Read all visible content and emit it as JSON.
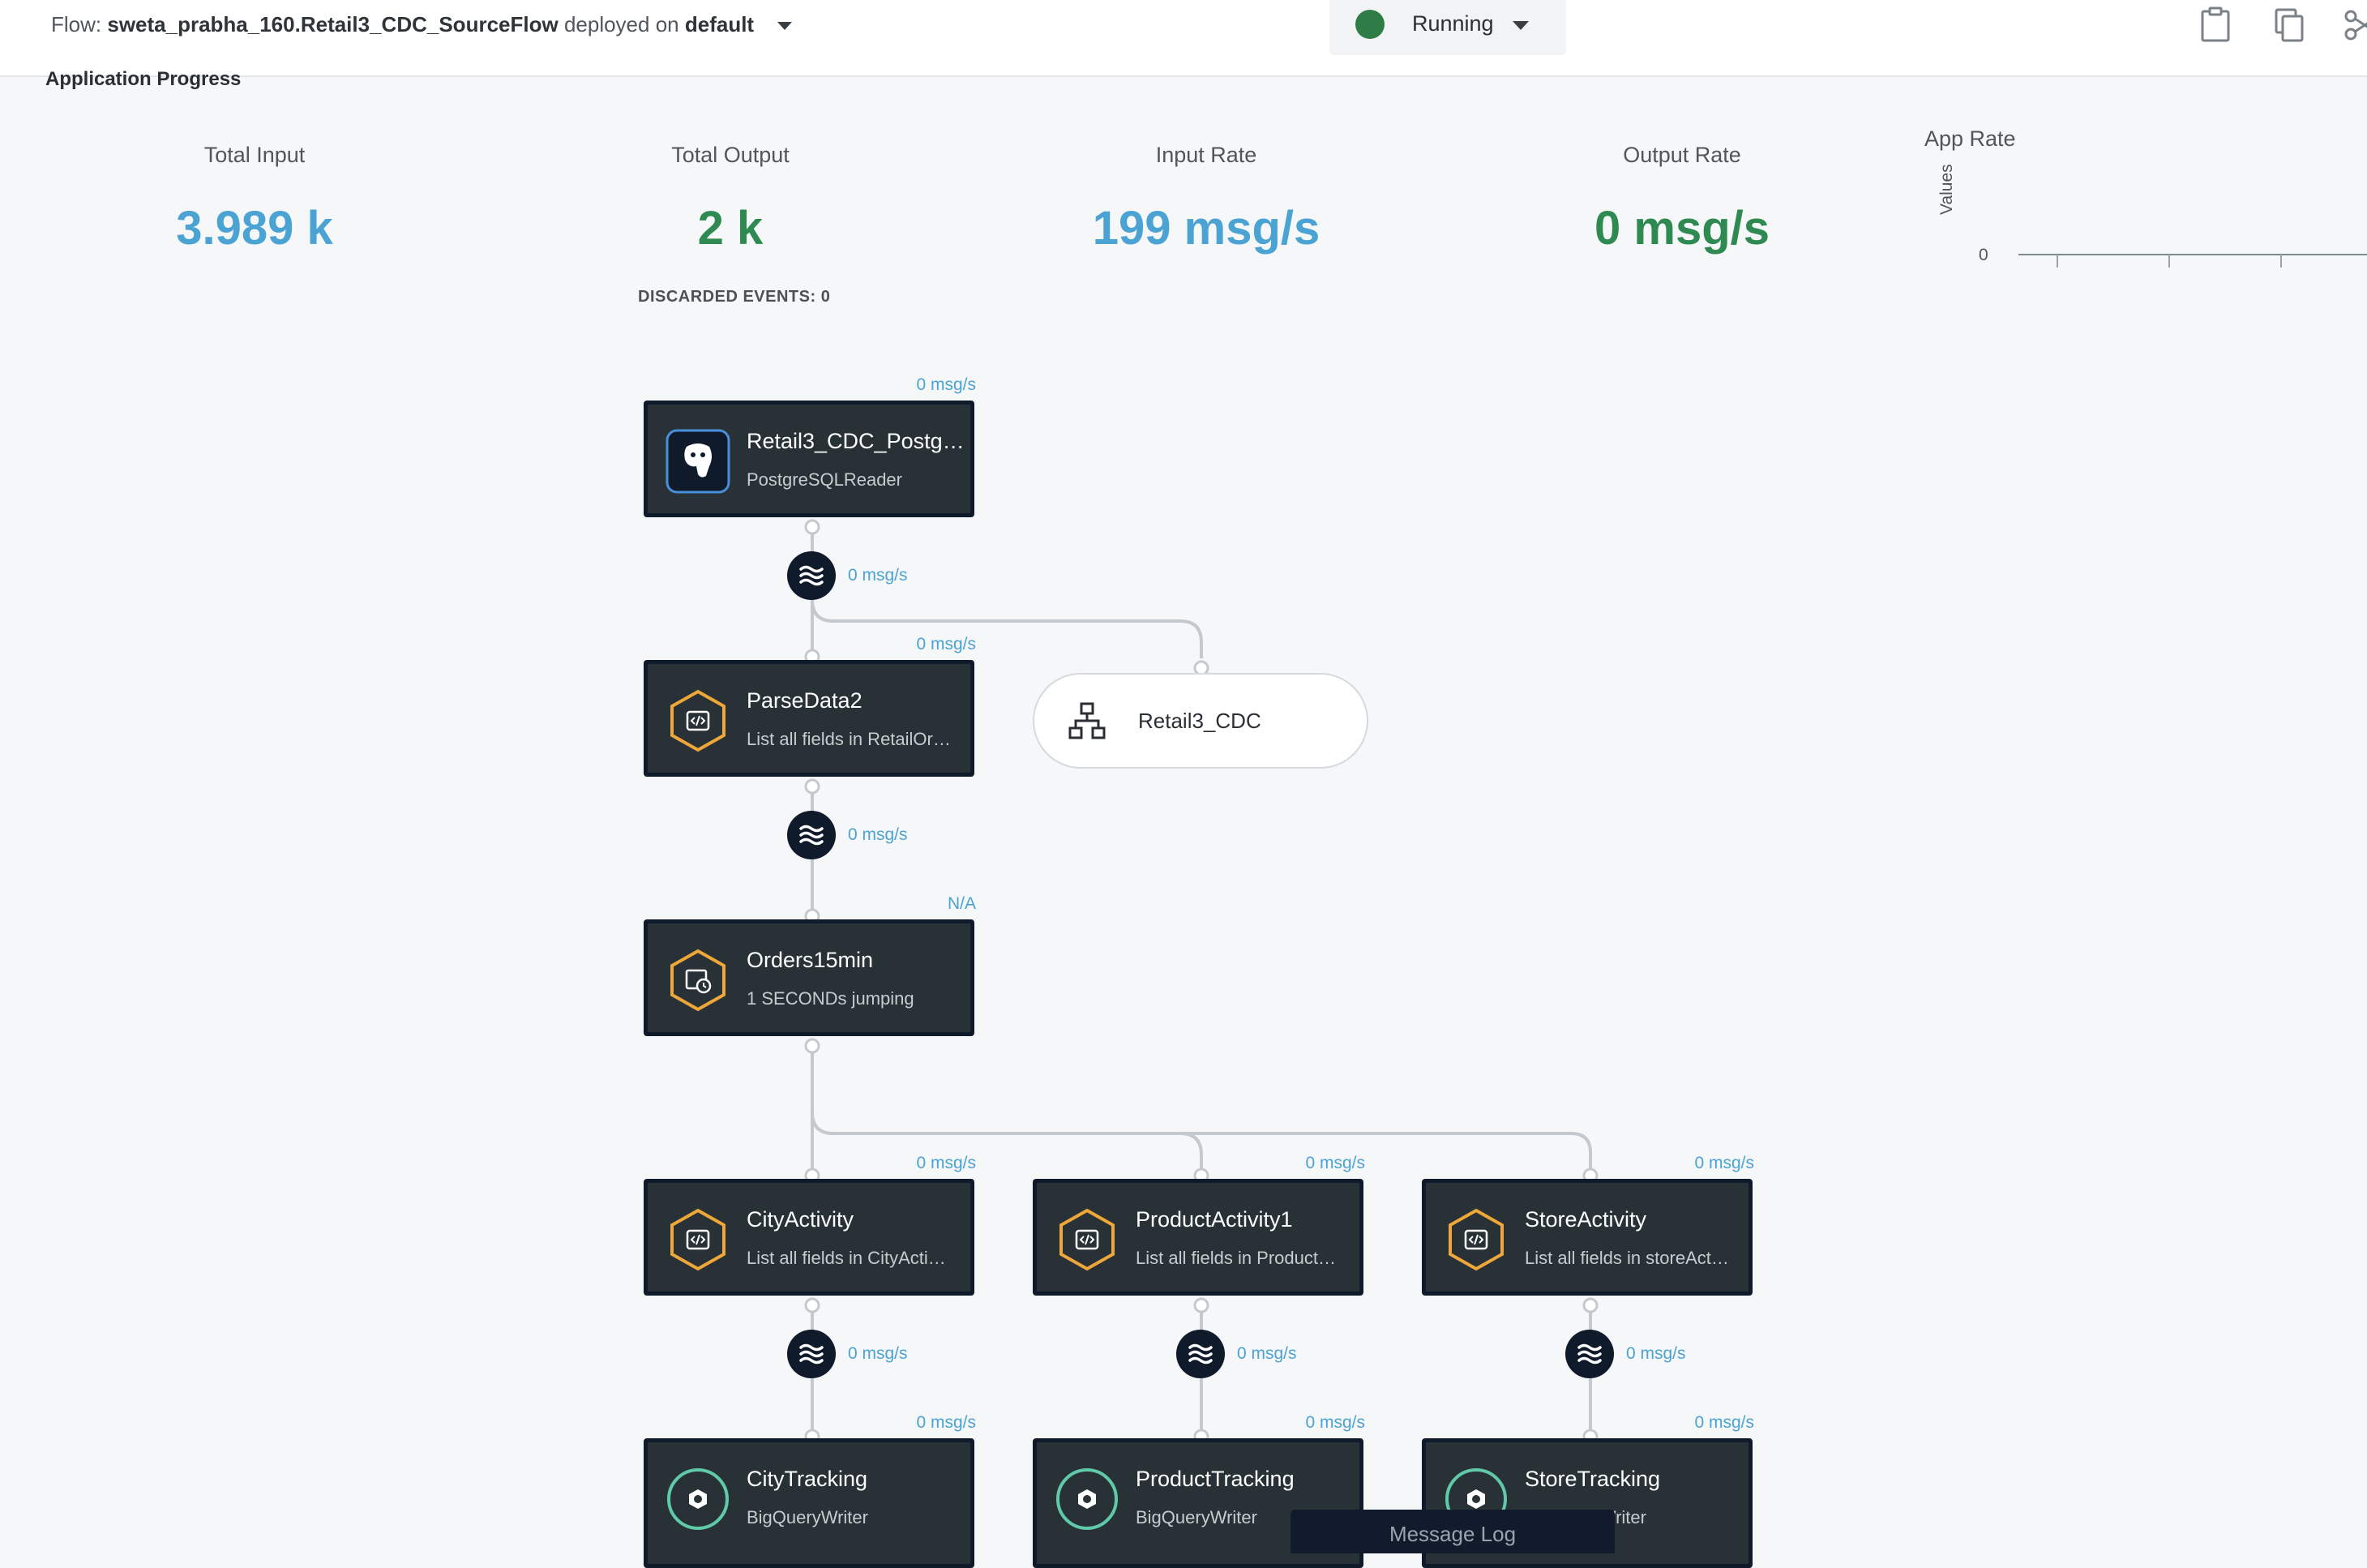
{
  "header": {
    "flow_prefix": "Flow:",
    "flow_name": "sweta_prabha_160.Retail3_CDC_SourceFlow",
    "deployed_text": "deployed on",
    "namespace": "default",
    "status": "Running",
    "status_color": "#2e7d46"
  },
  "progress": {
    "title": "Application Progress",
    "metrics": [
      {
        "label": "Total Input",
        "value": "3.989 k"
      },
      {
        "label": "Total Output",
        "value": "2 k"
      },
      {
        "label": "Input Rate",
        "value": "199 msg/s"
      },
      {
        "label": "Output Rate",
        "value": "0 msg/s"
      }
    ],
    "discarded": "DISCARDED EVENTS: 0",
    "app_rate": {
      "title": "App Rate",
      "y_label": "Values",
      "zero": "0"
    }
  },
  "nodes": {
    "source": {
      "name": "Retail3_CDC_Postgr…",
      "sub": "PostgreSQLReader",
      "rate": "0 msg/s"
    },
    "parse": {
      "name": "ParseData2",
      "sub": "List all fields in RetailOr…",
      "rate": "0 msg/s"
    },
    "window": {
      "name": "Orders15min",
      "sub": "1 SECONDs jumping",
      "rate": "N/A"
    },
    "city": {
      "name": "CityActivity",
      "sub": "List all fields in CityActi…",
      "rate": "0 msg/s"
    },
    "product": {
      "name": "ProductActivity1",
      "sub": "List all fields in Product…",
      "rate": "0 msg/s"
    },
    "store": {
      "name": "StoreActivity",
      "sub": "List all fields in storeAct…",
      "rate": "0 msg/s"
    },
    "city_tracking": {
      "name": "CityTracking",
      "sub": "BigQueryWriter",
      "rate": "0 msg/s"
    },
    "product_tracking": {
      "name": "ProductTracking",
      "sub": "BigQueryWriter",
      "rate": "0 msg/s"
    },
    "store_tracking": {
      "name": "StoreTracking",
      "sub": "BigQueryWriter",
      "rate": "0 msg/s"
    }
  },
  "streams": {
    "s1": "0 msg/s",
    "s2": "0 msg/s",
    "s3": "0 msg/s",
    "s4": "0 msg/s",
    "s5": "0 msg/s"
  },
  "cache": {
    "name": "Retail3_CDC"
  },
  "message_log": "Message Log",
  "colors": {
    "accent_blue": "#4ba3d3",
    "accent_green": "#2f8a52",
    "node_bg": "#283236",
    "hex_orange": "#f0a73a",
    "writer_teal": "#5fc9a8"
  }
}
